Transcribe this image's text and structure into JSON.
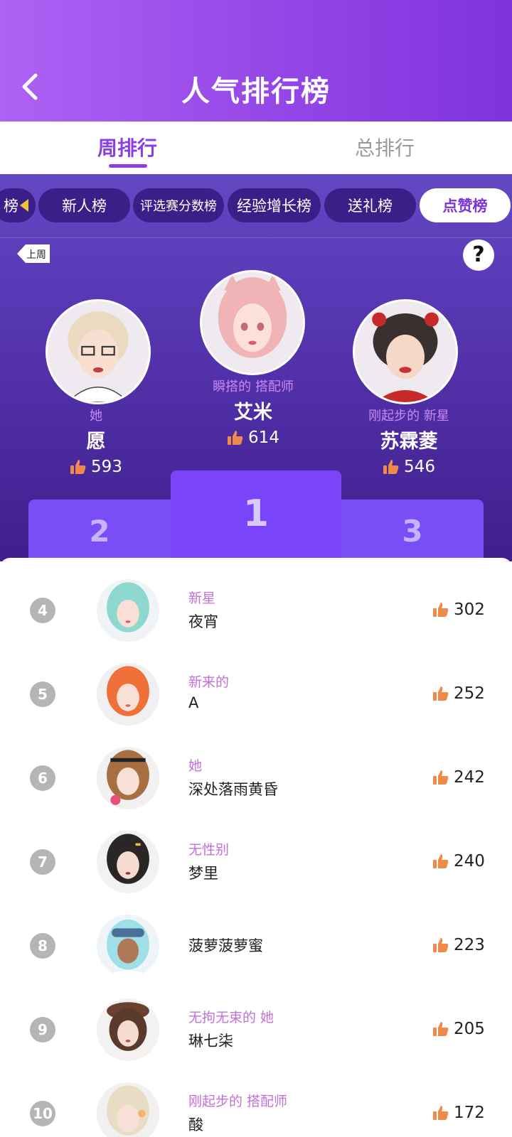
{
  "header": {
    "title": "人气排行榜"
  },
  "main_tabs": [
    {
      "label": "周排行"
    },
    {
      "label": "总排行"
    }
  ],
  "chips": {
    "partial": "榜",
    "items": [
      "新人榜",
      "评选赛分数榜",
      "经验增长榜",
      "送礼榜",
      "点赞榜"
    ]
  },
  "last_week": "上周",
  "help": "?",
  "podium": {
    "first": {
      "title": "瞬搭的 搭配师",
      "name": "艾米",
      "likes": "614",
      "rank": "1"
    },
    "second": {
      "title": "她",
      "name": "愿",
      "likes": "593",
      "rank": "2"
    },
    "third": {
      "title": "刚起步的 新星",
      "name": "苏霖菱",
      "likes": "546",
      "rank": "3"
    }
  },
  "list": [
    {
      "rank": "4",
      "title": "新星",
      "name": "夜宵",
      "likes": "302"
    },
    {
      "rank": "5",
      "title": "新来的",
      "name": "A",
      "likes": "252"
    },
    {
      "rank": "6",
      "title": "她",
      "name": "深处落雨黄昏",
      "likes": "242"
    },
    {
      "rank": "7",
      "title": "无性别",
      "name": "梦里",
      "likes": "240"
    },
    {
      "rank": "8",
      "title": "",
      "name": "菠萝菠萝蜜",
      "likes": "223"
    },
    {
      "rank": "9",
      "title": "无拘无束的 她",
      "name": "琳七柒",
      "likes": "205"
    },
    {
      "rank": "10",
      "title": "刚起步的 搭配师",
      "name": "酸",
      "likes": "172"
    }
  ],
  "colors": {
    "accent": "#8a3fe4",
    "board": "#4f2da4",
    "podium": "#7a4df7",
    "thumb": "#f08a4b"
  }
}
